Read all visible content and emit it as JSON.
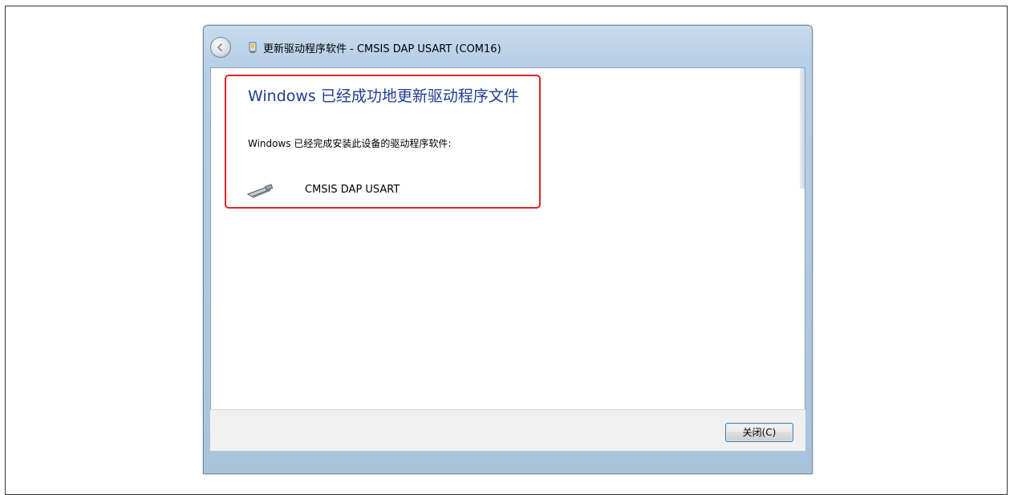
{
  "window": {
    "title": "更新驱动程序软件 - CMSIS DAP USART (COM16)"
  },
  "content": {
    "heading": "Windows 已经成功地更新驱动程序文件",
    "subtext": "Windows 已经完成安装此设备的驱动程序软件:",
    "device_name": "CMSIS DAP USART",
    "device_icon": "usb-device-icon"
  },
  "footer": {
    "close_label": "关闭(C)"
  },
  "colors": {
    "heading": "#1e3d96",
    "highlight_border": "#e02424",
    "button_border": "#3c7fb1"
  }
}
